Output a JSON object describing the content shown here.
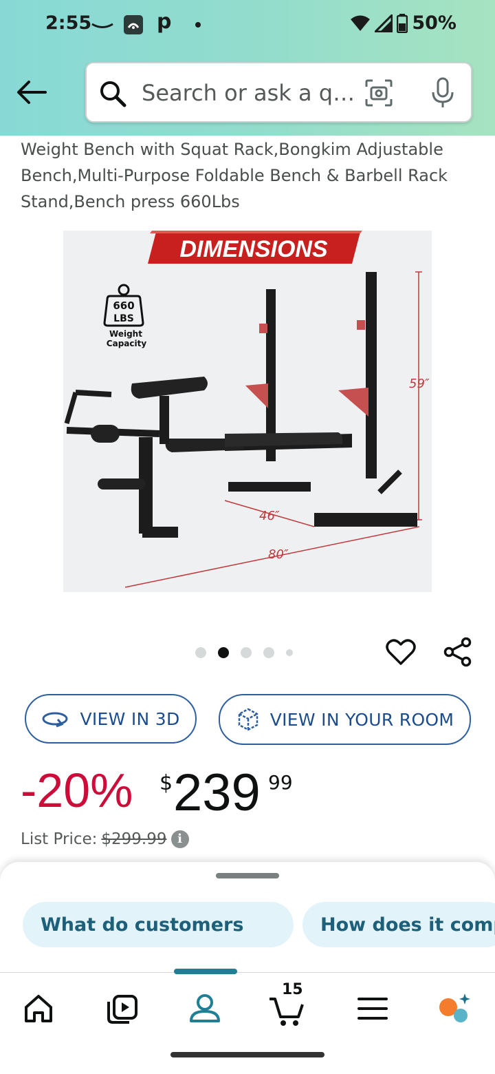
{
  "status_bar": {
    "time": "2:55",
    "notification_letter": "p",
    "battery": "50%"
  },
  "search": {
    "placeholder": "Search or ask a q…"
  },
  "product": {
    "title": "Weight Bench with Squat Rack,Bongkim Adjustable Bench,Multi-Purpose Foldable Bench & Barbell Rack Stand,Bench press 660Lbs",
    "image": {
      "banner": "DIMENSIONS",
      "capacity_number": "660",
      "capacity_unit": "LBS",
      "capacity_label_1": "Weight",
      "capacity_label_2": "Capacity",
      "height_dim": "59″",
      "width_dim": "46″",
      "length_dim": "80″"
    },
    "carousel": {
      "count": 5,
      "active_index": 1
    }
  },
  "actions": {
    "view_3d": "VIEW IN 3D",
    "view_room": "VIEW IN YOUR ROOM"
  },
  "price": {
    "discount": "-20%",
    "currency": "$",
    "whole": "239",
    "fraction": "99",
    "list_label": "List Price:",
    "list_value": "$299.99",
    "info_glyph": "i"
  },
  "sheet": {
    "chips": [
      "What do customers",
      "How does it comp"
    ]
  },
  "nav": {
    "items": [
      "home-icon",
      "video-icon",
      "account-icon",
      "cart-icon",
      "menu-icon",
      "rufus-icon"
    ],
    "cart_count": "15",
    "active_index": 2,
    "accent": "#1e7f95"
  },
  "colors": {
    "discount": "#cc0c39",
    "link_blue": "#1a4c8f",
    "banner_red": "#c8201e"
  }
}
